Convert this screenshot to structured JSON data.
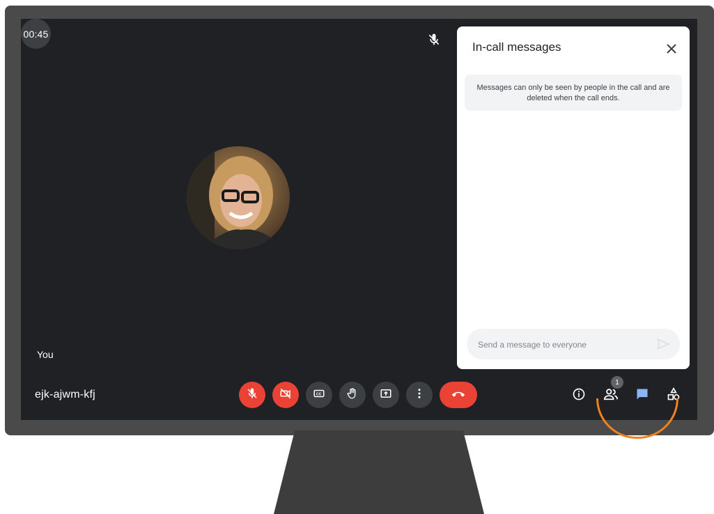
{
  "call": {
    "timer": "00:45",
    "participant_label": "You",
    "meeting_code": "ejk-ajwm-kfj"
  },
  "controls": {
    "mic_icon": "mic-off-icon",
    "camera_icon": "videocam-off-icon",
    "captions_icon": "closed-caption-icon",
    "raise_hand_icon": "hand-icon",
    "present_icon": "present-screen-icon",
    "more_icon": "more-vert-icon",
    "end_call_icon": "call-end-icon"
  },
  "right_controls": {
    "info_icon": "info-icon",
    "people_icon": "people-icon",
    "people_count": "1",
    "chat_icon": "chat-icon",
    "activities_icon": "activities-icon"
  },
  "chat_panel": {
    "title": "In-call messages",
    "notice": "Messages can only be seen by people in the call and are deleted when the call ends.",
    "input_placeholder": "Send a message to everyone"
  },
  "colors": {
    "screen_bg": "#202124",
    "button_bg": "#3c4043",
    "danger": "#ea4335",
    "accent": "#8ab4f8",
    "highlight_ring": "#f0821e"
  }
}
